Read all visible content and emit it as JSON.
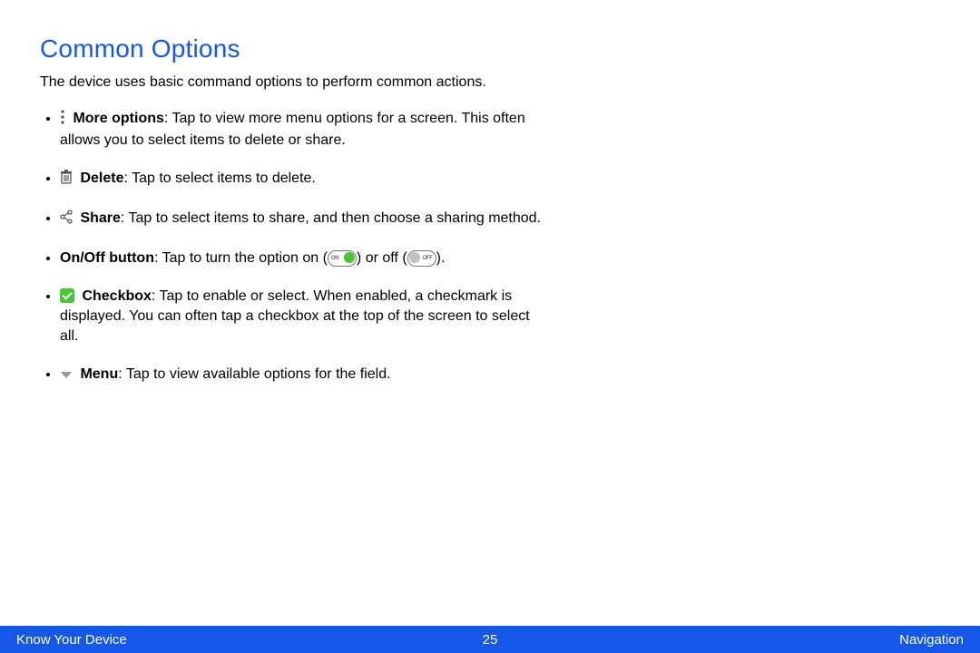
{
  "header": {
    "title": "Common Options"
  },
  "intro": "The device uses basic command options to perform common actions.",
  "items": {
    "more": {
      "label": "More options",
      "text": ": Tap to view more menu options for a screen. This often allows you to select items to delete or share."
    },
    "delete": {
      "label": "Delete",
      "text": ": Tap to select items to delete."
    },
    "share": {
      "label": "Share",
      "text": ": Tap to select items to share, and then choose a sharing method."
    },
    "onoff": {
      "label": "On/Off button",
      "text_prefix": ": Tap to turn the option on (",
      "text_mid": ") or off (",
      "text_suffix": ")."
    },
    "checkbox": {
      "label": "Checkbox",
      "text": ": Tap to enable or select. When enabled, a checkmark is displayed. You can often tap a checkbox at the top of the screen to select all."
    },
    "menu": {
      "label": "Menu",
      "text": ": Tap to view available options for the field."
    }
  },
  "toggle": {
    "on_label": "ON",
    "off_label": "OFF"
  },
  "footer": {
    "left": "Know Your Device",
    "page": "25",
    "right": "Navigation"
  }
}
